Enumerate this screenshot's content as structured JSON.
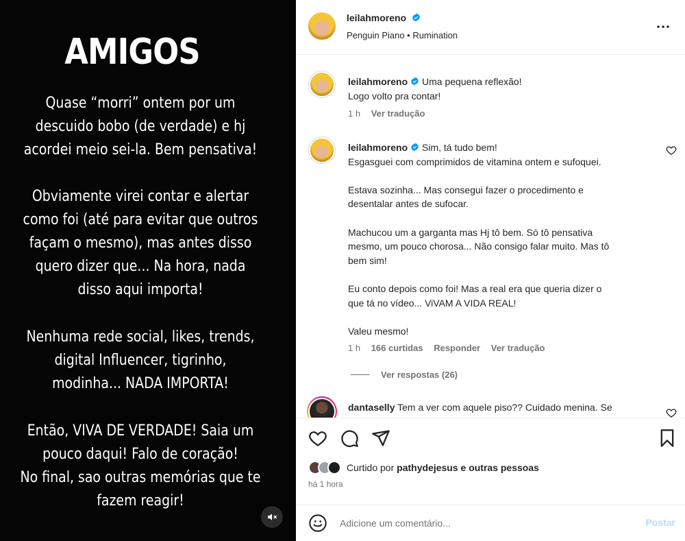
{
  "media": {
    "title": "AMIGOS",
    "paragraphs": [
      "Quase “morri” ontem por um\ndescuido bobo (de verdade) e hj\nacordei meio sei-la. Bem pensativa!",
      "Obviamente virei contar e alertar\ncomo foi (até para evitar que outros\nfaçam o mesmo), mas antes disso\nquero dizer que... Na hora, nada\ndisso aqui importa!",
      "Nenhuma rede social, likes, trends,\ndigital Influencer, tigrinho,\nmodinha... NADA IMPORTA!",
      "Então, VIVA DE VERDADE! Saia um\npouco daqui! Falo de coração!\nNo final, sao outras memórias que te\nfazem reagir!"
    ],
    "mute_icon": "speaker-muted-icon"
  },
  "header": {
    "username": "leilahmoreno",
    "audio": "Penguin Piano • Rumination"
  },
  "comments": [
    {
      "username": "leilahmoreno",
      "text": "Uma pequena reflexão!\nLogo volto pra contar!",
      "time": "1 h",
      "translate": "Ver tradução"
    },
    {
      "username": "leilahmoreno",
      "text": "Sim, tá tudo bem!\nEsgasguei com comprimidos de vitamina ontem e sufoquei.\n\nEstava sozinha... Mas consegui fazer o procedimento e\ndesentalar antes de sufocar.\n\nMachucou um a garganta mas Hj tô bem. Só tô pensativa\nmesmo, um pouco chorosa... Não consigo falar muito. Mas tô\nbem sim!\n\nEu conto depois como foi! Mas a real era que queria dizer o\nque tá no vídeo... ViVAM A VIDA REAL!\n\nValeu mesmo!",
      "time": "1 h",
      "likes": "166 curtidas",
      "reply": "Responder",
      "translate": "Ver tradução",
      "view_replies": "Ver respostas (26)"
    },
    {
      "username": "dantaselly",
      "text": "Tem a ver com aquele piso?? Cuidado menina. Se"
    }
  ],
  "footer": {
    "liked_prefix": "Curtido por",
    "liked_user": "pathydejesus",
    "liked_suffix": "e outras pessoas",
    "time_ago": "há 1 hora",
    "comment_placeholder": "Adicione um comentário...",
    "post_label": "Postar"
  },
  "colors": {
    "verified": "#0095f6",
    "post_disabled": "#b3dbff",
    "muted_text": "#737373"
  }
}
